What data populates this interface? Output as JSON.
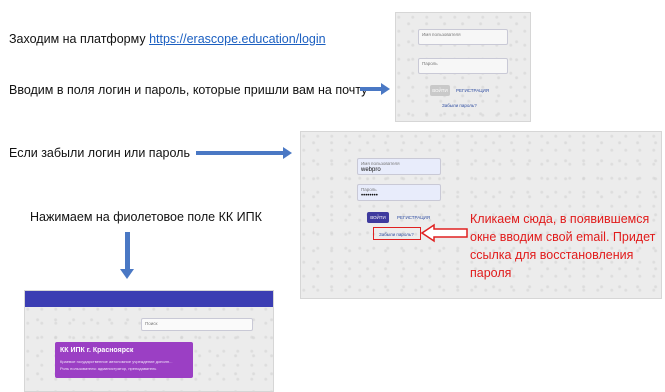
{
  "steps": {
    "step1_prefix": "Заходим на платформу ",
    "step1_link": "https://erascope.education/login",
    "step2": "Вводим в поля логин и пароль, которые пришли вам на почту",
    "step3": "Если забыли логин или пароль",
    "step4": "Нажимаем на фиолетовое поле КК ИПК"
  },
  "login_panel_1": {
    "username_label": "Имя пользователя",
    "password_label": "Пароль",
    "login_button": "ВОЙТИ",
    "register_link": "РЕГИСТРАЦИЯ",
    "forgot_link": "Забыли пароль?"
  },
  "login_panel_2": {
    "username_label": "Имя пользователя",
    "username_value": "webpro",
    "password_label": "Пароль",
    "password_value": "••••••••",
    "login_button": "ВОЙТИ",
    "register_link": "РЕГИСТРАЦИЯ",
    "forgot_link": "Забыли пароль?"
  },
  "callout": {
    "line1": "Кликаем сюда, в появившемся",
    "line2": "окне вводим свой email. Придет",
    "line3": "ссылка для восстановления",
    "line4": "пароля"
  },
  "kk_panel": {
    "search_placeholder": "Поиск",
    "card_title": "КК ИПК г. Красноярск",
    "card_subtitle_1": "Краевое государственное автономное учреждение дополн...",
    "card_subtitle_2": "Роль пользователя: администратор, преподаватель"
  },
  "colors": {
    "arrow": "#4a78c4",
    "callout_red": "#e11b1b",
    "purple_card": "#9b3fc4",
    "header_blue": "#3b3db3",
    "login_btn_purple": "#3e3a9e"
  }
}
